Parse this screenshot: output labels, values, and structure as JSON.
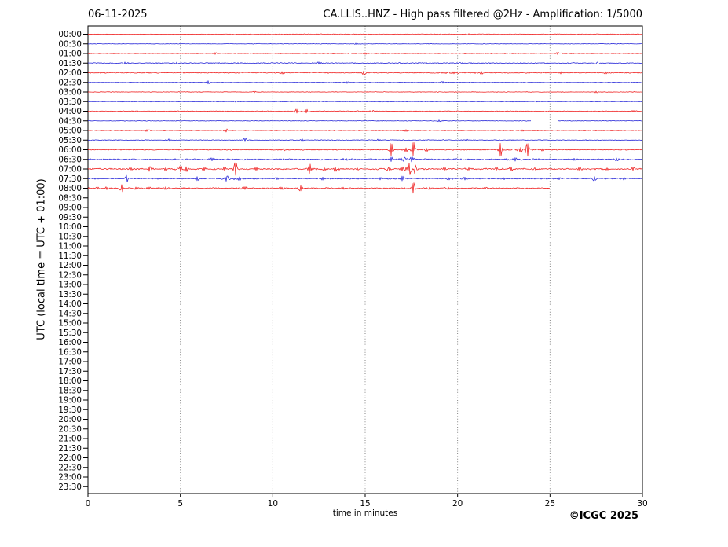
{
  "header": {
    "date": "06-11-2025",
    "title": "CA.LLIS..HNZ - High pass filtered @2Hz - Amplification: 1/5000"
  },
  "footer": {
    "credit": "©ICGC 2025"
  },
  "chart_data": {
    "type": "line",
    "subtype": "helicorder-seismogram",
    "title": "CA.LLIS..HNZ - High pass filtered @2Hz - Amplification: 1/5000",
    "date_label": "06-11-2025",
    "xlabel": "time in minutes",
    "ylabel": "UTC (local time = UTC + 01:00)",
    "xlim": [
      0,
      30
    ],
    "xticks": [
      0,
      5,
      10,
      15,
      20,
      25,
      30
    ],
    "xtick_labels": [
      "0",
      "5",
      "10",
      "15",
      "20",
      "25",
      "30"
    ],
    "row_interval_minutes": 30,
    "grid": "vertical dotted lines every 5 minutes",
    "legend": "none",
    "colors": {
      "red": "#ee1111",
      "blue": "#1a1ad6",
      "grid": "#777777",
      "axis": "#000000"
    },
    "rows": [
      {
        "label": "00:00",
        "color": "red",
        "active": true,
        "noise": 0.2,
        "noise_segments": [
          [
            0,
            6.1,
            0.2
          ],
          [
            6.1,
            30,
            0.45
          ]
        ],
        "events": [
          [
            20.6,
            0.9,
            0.5
          ]
        ]
      },
      {
        "label": "00:30",
        "color": "blue",
        "active": true,
        "noise": 0.35,
        "events": [
          [
            14.5,
            0.8,
            0.8
          ]
        ]
      },
      {
        "label": "01:00",
        "color": "red",
        "active": true,
        "noise": 0.45,
        "events": [
          [
            6.9,
            1.2,
            0.2
          ],
          [
            15.0,
            1.2,
            0.3
          ],
          [
            25.4,
            1.5,
            0.4
          ]
        ]
      },
      {
        "label": "01:30",
        "color": "blue",
        "active": true,
        "noise": 0.7,
        "events": [
          [
            2.0,
            1.3,
            0.4
          ],
          [
            4.8,
            1.2,
            0.5
          ],
          [
            12.5,
            1.5,
            0.4
          ],
          [
            27.6,
            1.4,
            0.5
          ]
        ]
      },
      {
        "label": "02:00",
        "color": "red",
        "active": true,
        "noise": 0.7,
        "events": [
          [
            10.5,
            1.5,
            0.4
          ],
          [
            14.9,
            2.2,
            0.35
          ],
          [
            19.8,
            1.4,
            2.5
          ],
          [
            21.3,
            1.8,
            0.3
          ],
          [
            25.6,
            1.6,
            0.4
          ],
          [
            28.0,
            1.3,
            0.4
          ]
        ]
      },
      {
        "label": "02:30",
        "color": "blue",
        "active": true,
        "noise": 0.35,
        "events": [
          [
            6.5,
            2.0,
            0.2
          ],
          [
            14.0,
            1.3,
            0.25
          ],
          [
            19.2,
            1.2,
            0.3
          ]
        ]
      },
      {
        "label": "03:00",
        "color": "red",
        "active": true,
        "noise": 0.4,
        "events": [
          [
            9.0,
            0.8,
            0.3
          ],
          [
            27.5,
            1.0,
            0.3
          ]
        ]
      },
      {
        "label": "03:30",
        "color": "blue",
        "active": true,
        "noise": 0.45,
        "events": [
          [
            8.0,
            0.8,
            0.4
          ]
        ]
      },
      {
        "label": "04:00",
        "color": "red",
        "active": true,
        "noise": 0.5,
        "events": [
          [
            11.3,
            2.5,
            0.5
          ],
          [
            11.8,
            2.2,
            0.4
          ],
          [
            15.4,
            1.2,
            0.3
          ],
          [
            29.5,
            1.0,
            0.3
          ]
        ]
      },
      {
        "label": "04:30",
        "color": "blue",
        "active": true,
        "noise": 0.4,
        "gaps": [
          [
            24.0,
            25.4
          ]
        ],
        "events": [
          [
            19.0,
            1.0,
            0.3
          ]
        ]
      },
      {
        "label": "05:00",
        "color": "red",
        "active": true,
        "noise": 0.5,
        "events": [
          [
            3.2,
            1.2,
            0.6
          ],
          [
            7.5,
            1.8,
            0.5
          ],
          [
            17.2,
            1.3,
            0.6
          ],
          [
            23.5,
            1.0,
            0.3
          ]
        ]
      },
      {
        "label": "05:30",
        "color": "blue",
        "active": true,
        "noise": 0.5,
        "events": [
          [
            4.4,
            1.5,
            0.3
          ],
          [
            8.5,
            2.2,
            0.2
          ],
          [
            11.6,
            1.8,
            0.3
          ],
          [
            15.7,
            1.3,
            0.4
          ],
          [
            20.5,
            1.0,
            0.3
          ]
        ]
      },
      {
        "label": "06:00",
        "color": "red",
        "active": true,
        "noise": 0.7,
        "events": [
          [
            10.6,
            1.5,
            0.3
          ],
          [
            16.4,
            7.5,
            0.25
          ],
          [
            17.2,
            2.5,
            0.3
          ],
          [
            17.6,
            8.5,
            0.35
          ],
          [
            18.3,
            2.0,
            0.3
          ],
          [
            22.3,
            8.0,
            0.25
          ],
          [
            23.4,
            3.0,
            0.5
          ],
          [
            23.8,
            8.5,
            0.3
          ],
          [
            24.6,
            1.5,
            0.3
          ]
        ]
      },
      {
        "label": "06:30",
        "color": "blue",
        "active": true,
        "noise": 0.9,
        "events": [
          [
            6.7,
            1.8,
            0.4
          ],
          [
            14.0,
            1.3,
            0.4
          ],
          [
            16.4,
            3.0,
            0.3
          ],
          [
            17.1,
            2.5,
            0.5
          ],
          [
            17.5,
            3.0,
            0.3
          ],
          [
            23.1,
            2.2,
            0.6
          ],
          [
            26.3,
            1.5,
            0.4
          ],
          [
            28.6,
            1.8,
            0.4
          ]
        ]
      },
      {
        "label": "07:00",
        "color": "red",
        "active": true,
        "noise": 1.0,
        "events": [
          [
            2.3,
            1.5,
            0.3
          ],
          [
            3.3,
            3.0,
            0.25
          ],
          [
            4.2,
            2.0,
            0.3
          ],
          [
            5.0,
            4.0,
            0.3
          ],
          [
            5.3,
            3.0,
            0.2
          ],
          [
            6.3,
            2.0,
            0.3
          ],
          [
            7.4,
            2.5,
            0.5
          ],
          [
            8.0,
            7.5,
            0.3
          ],
          [
            9.1,
            2.0,
            0.3
          ],
          [
            12.0,
            6.0,
            0.3
          ],
          [
            12.8,
            2.0,
            0.3
          ],
          [
            13.4,
            3.0,
            0.4
          ],
          [
            14.6,
            1.5,
            0.3
          ],
          [
            16.3,
            2.5,
            0.4
          ],
          [
            17.0,
            2.5,
            0.3
          ],
          [
            17.4,
            8.5,
            0.4
          ],
          [
            17.7,
            6.0,
            0.3
          ],
          [
            19.3,
            2.0,
            0.3
          ],
          [
            20.6,
            1.5,
            0.3
          ],
          [
            22.1,
            2.0,
            0.3
          ],
          [
            22.9,
            2.5,
            0.3
          ],
          [
            24.2,
            1.5,
            0.3
          ],
          [
            26.6,
            2.0,
            0.4
          ],
          [
            28.1,
            1.5,
            0.3
          ],
          [
            29.5,
            2.0,
            0.3
          ]
        ]
      },
      {
        "label": "07:30",
        "color": "blue",
        "active": true,
        "noise": 0.8,
        "events": [
          [
            2.1,
            4.0,
            0.15
          ],
          [
            5.9,
            2.5,
            0.2
          ],
          [
            7.5,
            3.0,
            0.8
          ],
          [
            8.2,
            2.0,
            0.3
          ],
          [
            10.2,
            1.5,
            0.3
          ],
          [
            12.7,
            2.0,
            0.3
          ],
          [
            15.8,
            1.5,
            0.3
          ],
          [
            17.0,
            3.0,
            0.3
          ],
          [
            19.5,
            1.5,
            0.6
          ],
          [
            20.4,
            2.0,
            0.3
          ],
          [
            22.5,
            1.5,
            0.4
          ],
          [
            25.5,
            1.5,
            0.3
          ],
          [
            27.4,
            2.5,
            0.6
          ],
          [
            29.0,
            1.5,
            0.3
          ]
        ]
      },
      {
        "label": "08:00",
        "color": "red",
        "active": true,
        "noise": 0.8,
        "end": 25.0,
        "events": [
          [
            0.5,
            1.5,
            0.3
          ],
          [
            1.0,
            1.8,
            0.3
          ],
          [
            1.85,
            5.0,
            0.3
          ],
          [
            2.6,
            1.5,
            0.3
          ],
          [
            3.3,
            1.5,
            0.3
          ],
          [
            4.2,
            1.8,
            0.5
          ],
          [
            8.5,
            1.8,
            0.5
          ],
          [
            10.5,
            1.5,
            0.3
          ],
          [
            11.5,
            3.5,
            0.35
          ],
          [
            13.8,
            1.5,
            0.3
          ],
          [
            17.6,
            6.5,
            0.3
          ],
          [
            18.5,
            1.5,
            0.4
          ],
          [
            19.5,
            1.5,
            0.4
          ],
          [
            21.5,
            1.2,
            0.3
          ]
        ]
      },
      {
        "label": "08:30",
        "color": "blue",
        "active": false
      },
      {
        "label": "09:00",
        "color": "red",
        "active": false
      },
      {
        "label": "09:30",
        "color": "blue",
        "active": false
      },
      {
        "label": "10:00",
        "color": "red",
        "active": false
      },
      {
        "label": "10:30",
        "color": "blue",
        "active": false
      },
      {
        "label": "11:00",
        "color": "red",
        "active": false
      },
      {
        "label": "11:30",
        "color": "blue",
        "active": false
      },
      {
        "label": "12:00",
        "color": "red",
        "active": false
      },
      {
        "label": "12:30",
        "color": "blue",
        "active": false
      },
      {
        "label": "13:00",
        "color": "red",
        "active": false
      },
      {
        "label": "13:30",
        "color": "blue",
        "active": false
      },
      {
        "label": "14:00",
        "color": "red",
        "active": false
      },
      {
        "label": "14:30",
        "color": "blue",
        "active": false
      },
      {
        "label": "15:00",
        "color": "red",
        "active": false
      },
      {
        "label": "15:30",
        "color": "blue",
        "active": false
      },
      {
        "label": "16:00",
        "color": "red",
        "active": false
      },
      {
        "label": "16:30",
        "color": "blue",
        "active": false
      },
      {
        "label": "17:00",
        "color": "red",
        "active": false
      },
      {
        "label": "17:30",
        "color": "blue",
        "active": false
      },
      {
        "label": "18:00",
        "color": "red",
        "active": false
      },
      {
        "label": "18:30",
        "color": "blue",
        "active": false
      },
      {
        "label": "19:00",
        "color": "red",
        "active": false
      },
      {
        "label": "19:30",
        "color": "blue",
        "active": false
      },
      {
        "label": "20:00",
        "color": "red",
        "active": false
      },
      {
        "label": "20:30",
        "color": "blue",
        "active": false
      },
      {
        "label": "21:00",
        "color": "red",
        "active": false
      },
      {
        "label": "21:30",
        "color": "blue",
        "active": false
      },
      {
        "label": "22:00",
        "color": "red",
        "active": false
      },
      {
        "label": "22:30",
        "color": "blue",
        "active": false
      },
      {
        "label": "23:00",
        "color": "red",
        "active": false
      },
      {
        "label": "23:30",
        "color": "blue",
        "active": false
      }
    ]
  }
}
